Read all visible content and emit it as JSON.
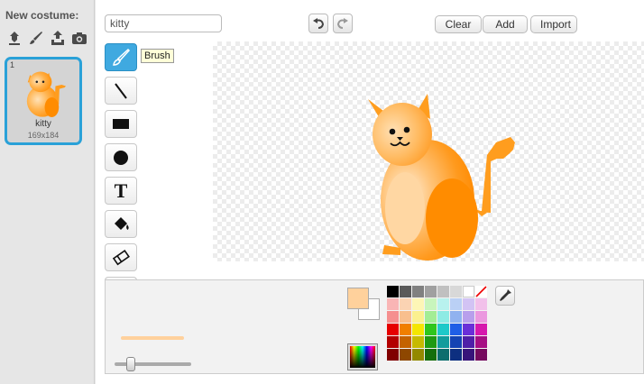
{
  "sidebar": {
    "new_costume_label": "New costume:",
    "icons": [
      "paint-library-icon",
      "paintbrush-icon",
      "upload-icon",
      "camera-icon"
    ],
    "costumes": [
      {
        "number": "1",
        "name": "kitty",
        "size": "169x184"
      }
    ]
  },
  "toolbar": {
    "costume_name_value": "kitty",
    "undo_icon": "undo-icon",
    "redo_icon": "redo-icon",
    "clear_label": "Clear",
    "add_label": "Add",
    "import_label": "Import"
  },
  "tools": {
    "items": [
      "brush",
      "line",
      "rectangle",
      "ellipse",
      "text",
      "fill",
      "eraser"
    ],
    "selected": "brush",
    "text_tool_glyph": "T",
    "tooltip": "Brush"
  },
  "colors": {
    "accent": "#3fa9e0",
    "foreground": "#ffd19c",
    "background": "#ffffff",
    "palette": [
      "#000000",
      "#5a5a5a",
      "#808080",
      "#a0a0a0",
      "#c0c0c0",
      "#d8d8d8",
      "#ffffff",
      "transparent",
      "#f9b5b5",
      "#fbd3b3",
      "#fdf6b6",
      "#c8f5bc",
      "#b8f2ee",
      "#bad0f5",
      "#d2c3f4",
      "#f2c0ea",
      "#f58f8f",
      "#f8bf8e",
      "#fbf08f",
      "#a3ed95",
      "#8debe4",
      "#90b2ef",
      "#b89fec",
      "#eb98df",
      "#e60000",
      "#f07f00",
      "#f4e600",
      "#2fc61d",
      "#1ec9c9",
      "#1f5ee6",
      "#6a2fd8",
      "#d618ad",
      "#b30000",
      "#c46200",
      "#c6ba00",
      "#1f9a12",
      "#139c9c",
      "#1443b3",
      "#4f1fa8",
      "#a60f84",
      "#800000",
      "#8e4700",
      "#938900",
      "#156e0c",
      "#0c6e6e",
      "#0d2f80",
      "#37147a",
      "#750a5e"
    ]
  }
}
